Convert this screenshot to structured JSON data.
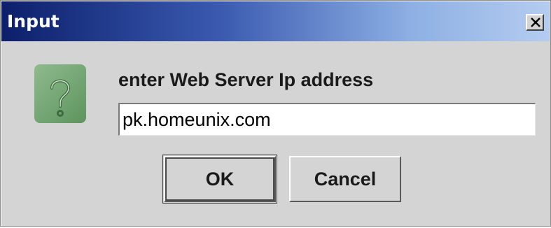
{
  "window": {
    "title": "Input",
    "close_icon": "close-icon"
  },
  "prompt": {
    "icon": "question-icon",
    "label": "enter Web Server Ip address"
  },
  "input": {
    "value": "pk.homeunix.com"
  },
  "buttons": {
    "ok_label": "OK",
    "cancel_label": "Cancel"
  },
  "colors": {
    "titlebar_start": "#0c1f6b",
    "titlebar_end": "#b4ccf0",
    "dialog_background": "#d4d4d4",
    "icon_green": "#6fa36f"
  }
}
